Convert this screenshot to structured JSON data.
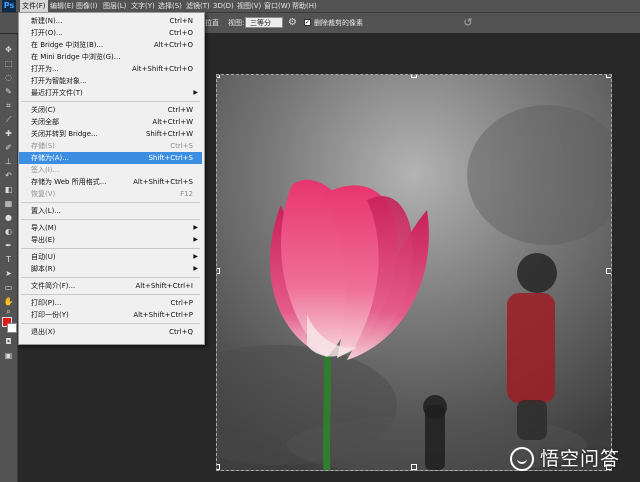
{
  "app": {
    "logo": "Ps"
  },
  "menubar": {
    "items": [
      {
        "label": "文件(F)",
        "active": true
      },
      {
        "label": "编辑(E)"
      },
      {
        "label": "图像(I)"
      },
      {
        "label": "图层(L)"
      },
      {
        "label": "文字(Y)"
      },
      {
        "label": "选择(S)"
      },
      {
        "label": "滤镜(T)"
      },
      {
        "label": "3D(D)"
      },
      {
        "label": "视图(V)"
      },
      {
        "label": "窗口(W)"
      },
      {
        "label": "帮助(H)"
      }
    ]
  },
  "options_bar": {
    "straighten_label": "拉直",
    "view_label": "视图:",
    "view_value": "三等分",
    "delete_cropped_label": "删除裁剪的像素",
    "delete_cropped_checked": true
  },
  "file_menu": {
    "items": [
      {
        "label": "新建(N)...",
        "shortcut": "Ctrl+N"
      },
      {
        "label": "打开(O)...",
        "shortcut": "Ctrl+O"
      },
      {
        "label": "在 Bridge 中浏览(B)...",
        "shortcut": "Alt+Ctrl+O"
      },
      {
        "label": "在 Mini Bridge 中浏览(G)...",
        "shortcut": ""
      },
      {
        "label": "打开为...",
        "shortcut": "Alt+Shift+Ctrl+O"
      },
      {
        "label": "打开为智能对象...",
        "shortcut": ""
      },
      {
        "label": "最近打开文件(T)",
        "shortcut": "",
        "submenu": true
      },
      {
        "separator": true
      },
      {
        "label": "关闭(C)",
        "shortcut": "Ctrl+W"
      },
      {
        "label": "关闭全部",
        "shortcut": "Alt+Ctrl+W"
      },
      {
        "label": "关闭并转到 Bridge...",
        "shortcut": "Shift+Ctrl+W"
      },
      {
        "label": "存储(S)",
        "shortcut": "Ctrl+S",
        "disabled": true
      },
      {
        "label": "存储为(A)...",
        "shortcut": "Shift+Ctrl+S",
        "highlighted": true
      },
      {
        "label": "签入(I)...",
        "shortcut": "",
        "disabled": true
      },
      {
        "label": "存储为 Web 所用格式...",
        "shortcut": "Alt+Shift+Ctrl+S"
      },
      {
        "label": "恢复(V)",
        "shortcut": "F12",
        "disabled": true
      },
      {
        "separator": true
      },
      {
        "label": "置入(L)...",
        "shortcut": ""
      },
      {
        "separator": true
      },
      {
        "label": "导入(M)",
        "shortcut": "",
        "submenu": true
      },
      {
        "label": "导出(E)",
        "shortcut": "",
        "submenu": true
      },
      {
        "separator": true
      },
      {
        "label": "自动(U)",
        "shortcut": "",
        "submenu": true
      },
      {
        "label": "脚本(R)",
        "shortcut": "",
        "submenu": true
      },
      {
        "separator": true
      },
      {
        "label": "文件简介(F)...",
        "shortcut": "Alt+Shift+Ctrl+I"
      },
      {
        "separator": true
      },
      {
        "label": "打印(P)...",
        "shortcut": "Ctrl+P"
      },
      {
        "label": "打印一份(Y)",
        "shortcut": "Alt+Shift+Ctrl+P"
      },
      {
        "separator": true
      },
      {
        "label": "退出(X)",
        "shortcut": "Ctrl+Q"
      }
    ]
  },
  "tools": [
    "move-icon",
    "marquee-icon",
    "lasso-icon",
    "quick-select-icon",
    "crop-icon",
    "eyedropper-icon",
    "spot-heal-icon",
    "brush-icon",
    "clone-stamp-icon",
    "history-brush-icon",
    "eraser-icon",
    "gradient-icon",
    "blur-icon",
    "dodge-icon",
    "pen-icon",
    "type-icon",
    "path-select-icon",
    "rectangle-icon",
    "hand-icon",
    "zoom-icon"
  ],
  "colors": {
    "foreground": "#e01818",
    "background": "#ffffff",
    "menu_highlight": "#3c8ee3"
  },
  "watermark": {
    "text": "悟空问答"
  }
}
